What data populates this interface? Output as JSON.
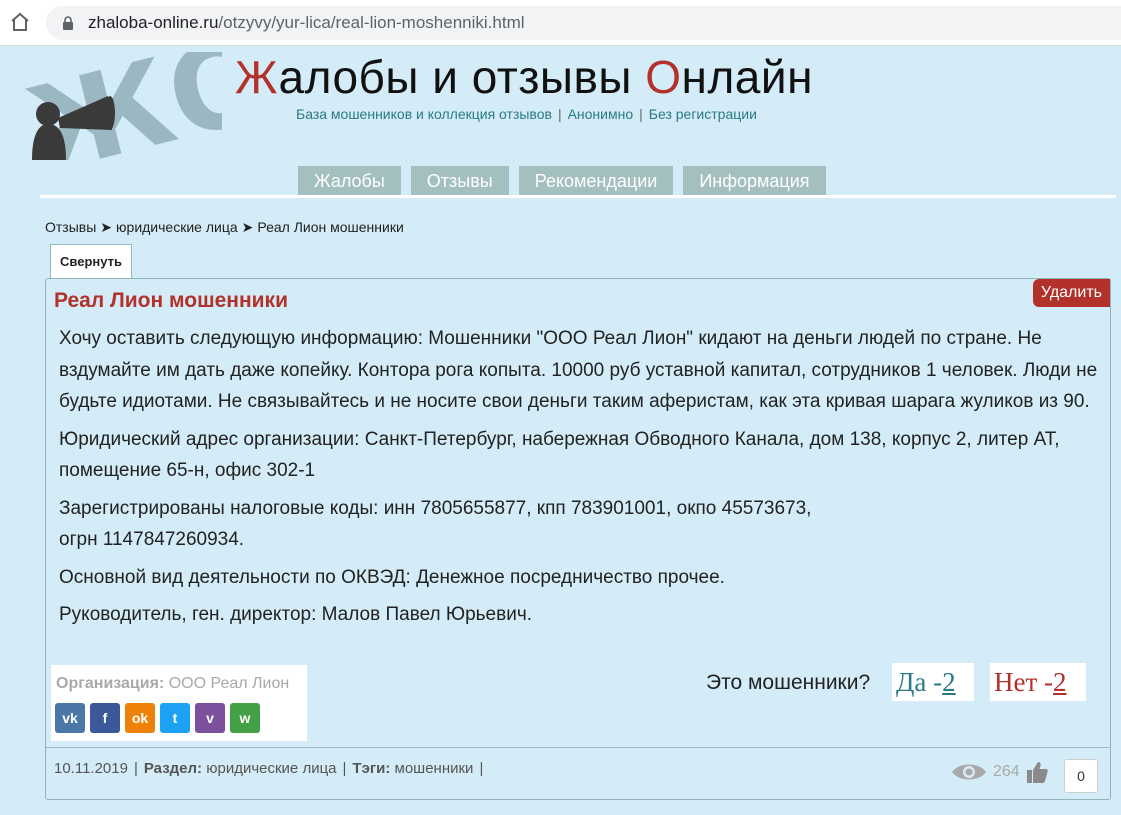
{
  "browser": {
    "url_host": "zhaloba-online.ru",
    "url_path": "/otzyvy/yur-lica/real-lion-moshenniki.html"
  },
  "site": {
    "title_parts": [
      "Ж",
      "алобы и отзывы ",
      "О",
      "нлайн"
    ],
    "tagline_items": [
      "База мошенников и коллекция отзывов",
      "Анонимно",
      "Без регистрации"
    ],
    "tagline_separator": "|"
  },
  "nav": {
    "items": [
      "Жалобы",
      "Отзывы",
      "Рекомендации",
      "Информация"
    ]
  },
  "breadcrumb": {
    "items": [
      "Отзывы",
      "юридические лица",
      "Реал Лион мошенники"
    ],
    "separator": "➤"
  },
  "collapse_label": "Свернуть",
  "card": {
    "title": "Реал Лион мошенники",
    "delete_label": "Удалить",
    "paragraphs": [
      "Хочу оставить следующую информацию: Мошенники \"ООО Реал Лион\" кидают на деньги людей по стране. Не вздумайте им дать даже копейку. Контора рога копыта. 10000 руб уставной капитал, сотрудников 1 человек. Люди не будьте идиотами. Не связывайтесь и не носите свои деньги таким аферистам, как эта кривая шарага жуликов из 90.",
      "Юридический адрес организации: Санкт-Петербург, набережная Обводного Канала, дом 138, корпус 2, литер АТ, помещение 65-н, офис 302-1",
      "Зарегистрированы налоговые коды: инн 7805655877, кпп 783901001, окпо 45573673,",
      "огрн 1147847260934.",
      "Основной вид деятельности по ОКВЭД: Денежное посредничество прочее.",
      "Руководитель, ген. директор: Малов Павел Юрьевич."
    ],
    "org_label": "Организация:",
    "org_value": "ООО Реал Лион",
    "share": [
      {
        "icon": "vk-icon",
        "glyph": "vk",
        "color": "#4a76a8"
      },
      {
        "icon": "facebook-icon",
        "glyph": "f",
        "color": "#3b5998"
      },
      {
        "icon": "odnoklassniki-icon",
        "glyph": "ok",
        "color": "#ee8208"
      },
      {
        "icon": "twitter-icon",
        "glyph": "t",
        "color": "#1da1f2"
      },
      {
        "icon": "viber-icon",
        "glyph": "v",
        "color": "#7b519d"
      },
      {
        "icon": "whatsapp-icon",
        "glyph": "w",
        "color": "#43a047"
      }
    ],
    "vote_question": "Это мошенники?",
    "vote_yes_label": "Да -",
    "vote_yes_count": "2",
    "vote_no_label": "Нет -",
    "vote_no_count": "2",
    "meta": {
      "date": "10.11.2019",
      "section_label": "Раздел:",
      "section_value": "юридические лица",
      "tags_label": "Тэги:",
      "tags_value": "мошенники",
      "separator": "|"
    },
    "views_count": "264",
    "likes_count": "0"
  },
  "colors": {
    "accent_red": "#b3312b",
    "accent_teal": "#2a7a86",
    "page_bg": "#d3ecf7",
    "nav_bg": "#a3bfbf"
  }
}
